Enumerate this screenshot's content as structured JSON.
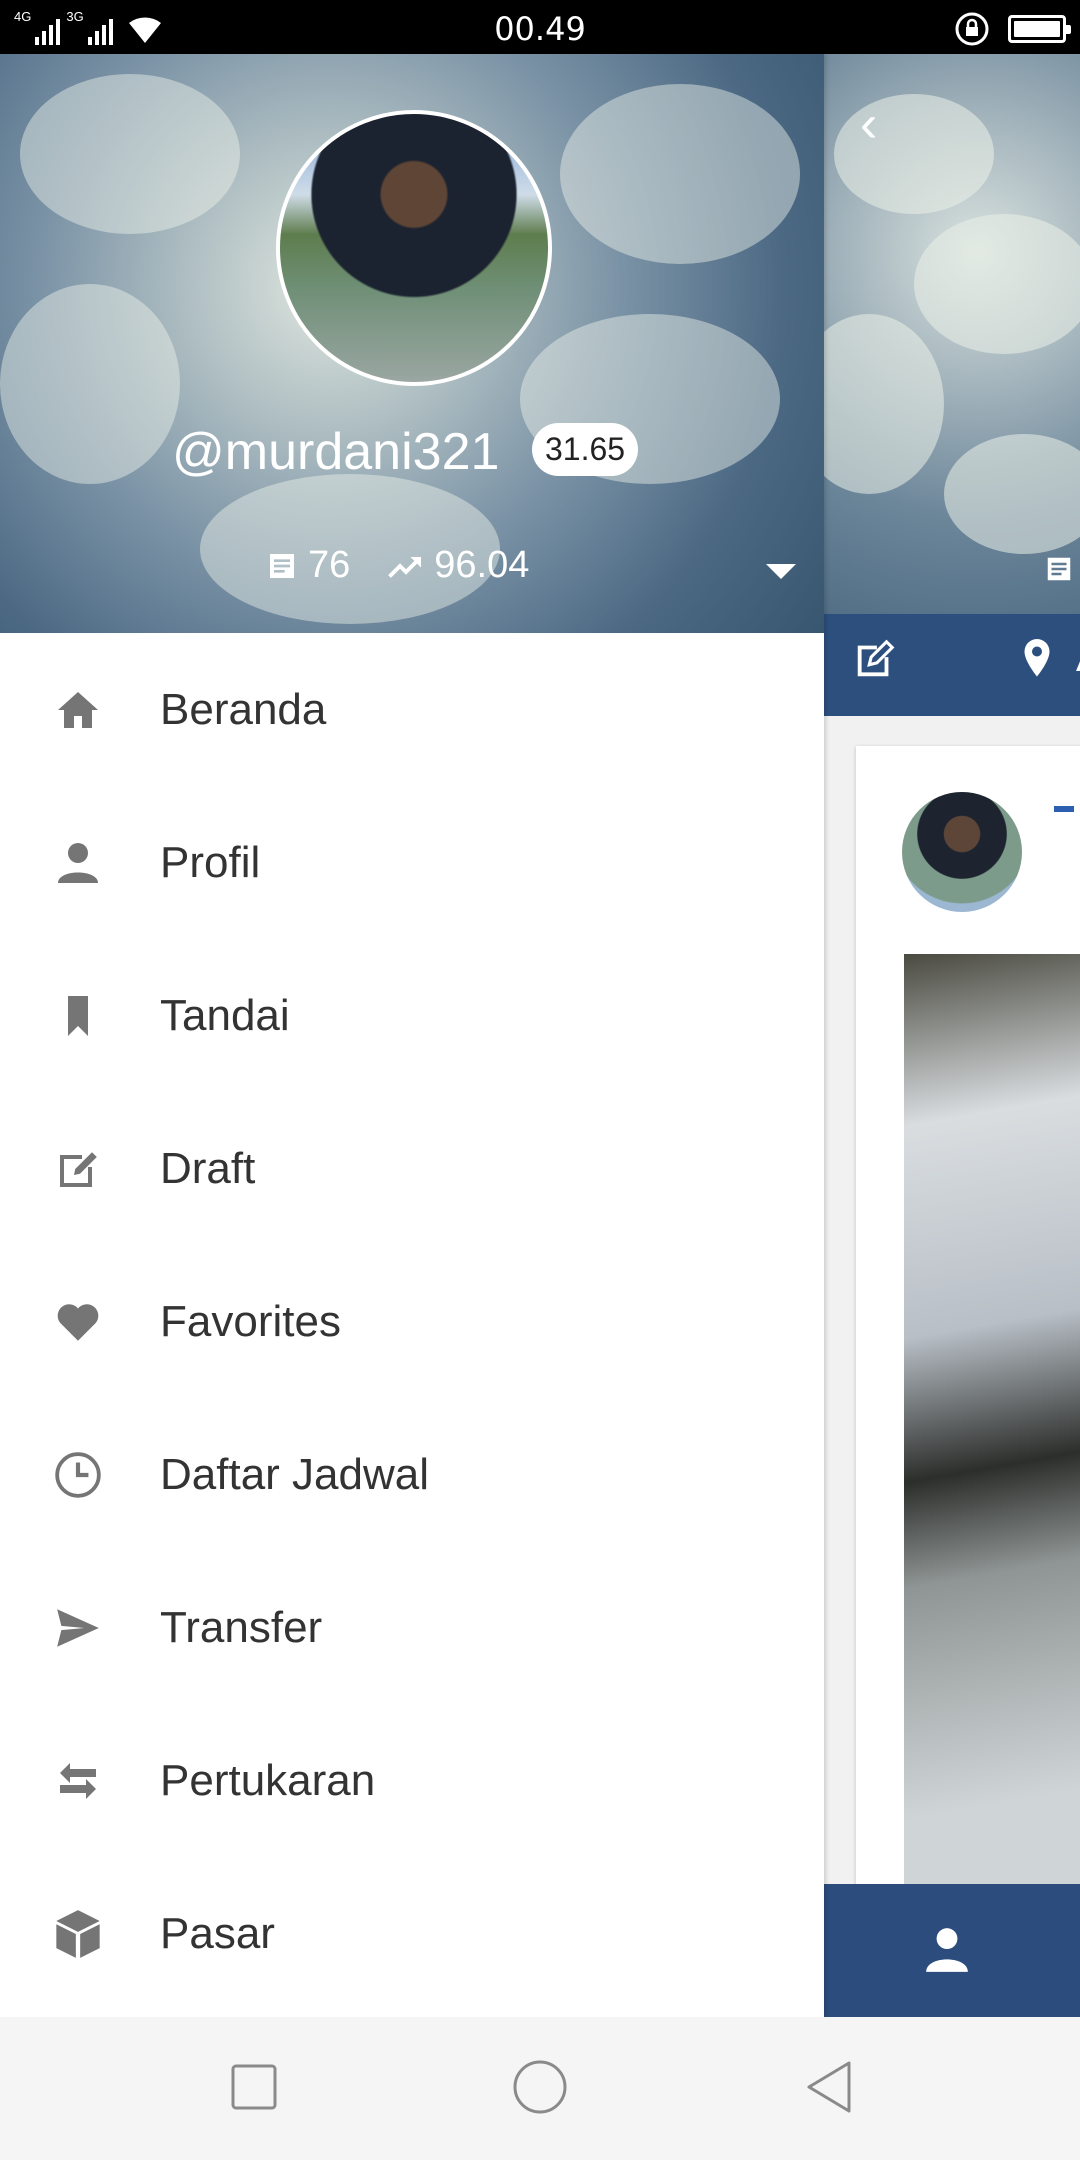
{
  "status_bar": {
    "network_1": "4G",
    "network_2": "3G",
    "time": "00.49"
  },
  "drawer": {
    "username": "@murdani321",
    "reputation": "31.65",
    "post_count": "76",
    "voting_power": "96.04",
    "menu_items": [
      {
        "label": "Beranda",
        "icon": "home-icon"
      },
      {
        "label": "Profil",
        "icon": "person-icon"
      },
      {
        "label": "Tandai",
        "icon": "bookmark-icon"
      },
      {
        "label": "Draft",
        "icon": "edit-icon"
      },
      {
        "label": "Favorites",
        "icon": "heart-icon"
      },
      {
        "label": "Daftar Jadwal",
        "icon": "clock-icon"
      },
      {
        "label": "Transfer",
        "icon": "send-icon"
      },
      {
        "label": "Pertukaran",
        "icon": "swap-icon"
      },
      {
        "label": "Pasar",
        "icon": "cube-icon"
      }
    ]
  },
  "background_page": {
    "location_partial": "Ac"
  }
}
